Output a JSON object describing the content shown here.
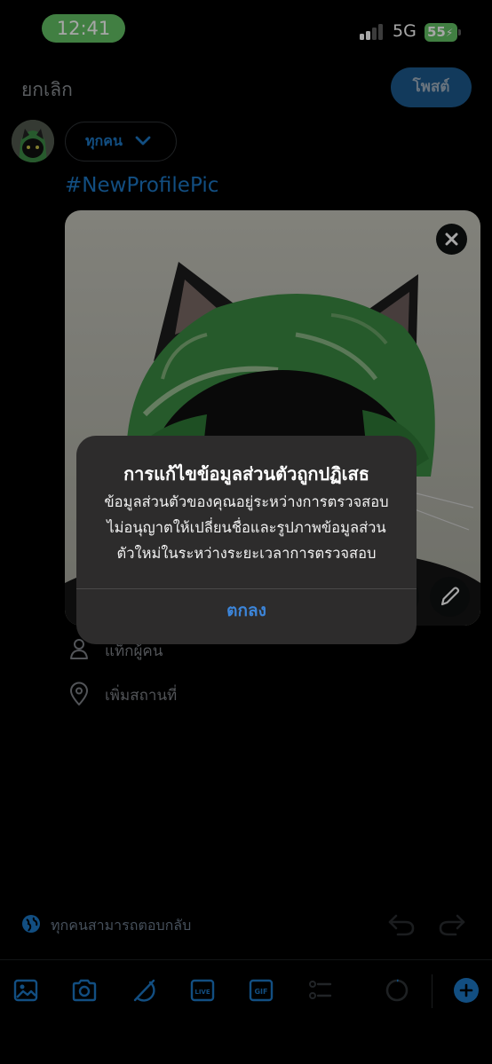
{
  "status_bar": {
    "time": "12:41",
    "network": "5G",
    "battery": "55"
  },
  "composer": {
    "cancel_label": "ยกเลิก",
    "post_label": "โพสต์",
    "audience_label": "ทุกคน",
    "text": "#NewProfilePic",
    "tag_people_label": "แท็กผู้คน",
    "add_location_label": "เพิ่มสถานที่",
    "reply_setting_label": "ทุกคนสามารถตอบกลับ"
  },
  "toolbar": {
    "items": [
      "image-icon",
      "camera-icon",
      "slash-circle-icon",
      "live-icon",
      "gif-icon",
      "poll-icon",
      "progress-ring-icon",
      "add-icon"
    ],
    "live_label": "LIVE",
    "gif_label": "GIF"
  },
  "alert": {
    "title": "การแก้ไขข้อมูลส่วนตัวถูกปฏิเสธ",
    "message_lines": [
      "ข้อมูลส่วนตัวของคุณอยู่ระหว่างการตรวจสอบ",
      "ไม่อนุญาตให้เปลี่ยนชื่อและรูปภาพข้อมูลส่วน",
      "ตัวใหม่ในระหว่างระยะเวลาการตรวจสอบ"
    ],
    "ok_label": "ตกลง"
  },
  "colors": {
    "accent": "#1d78c7",
    "status_green": "#65c466",
    "alert_bg": "#2d2c2c",
    "alert_button": "#3c85d9"
  }
}
